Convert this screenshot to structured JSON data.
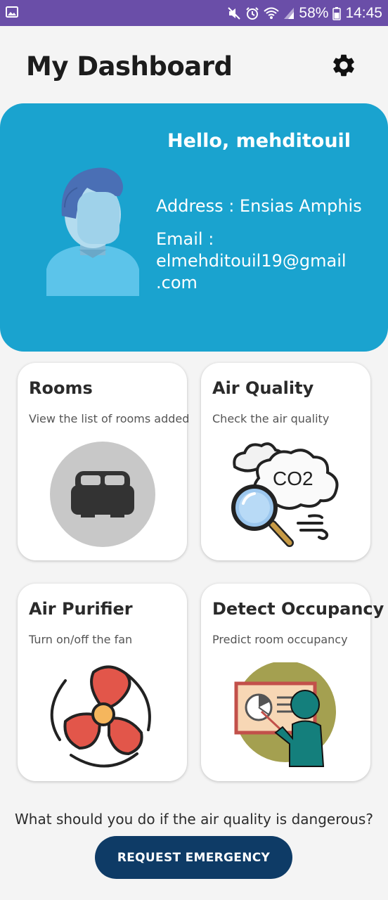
{
  "status_bar": {
    "battery_percent": "58%",
    "time": "14:45",
    "icons": [
      "image-icon",
      "mute-icon",
      "alarm-icon",
      "wifi-icon",
      "signal-icon",
      "battery-icon"
    ],
    "color": "#6a4ea8"
  },
  "header": {
    "title": "My Dashboard",
    "settings_icon": "gear-icon"
  },
  "profile": {
    "greeting": "Hello, mehditouil",
    "address": "Address : Ensias Amphis",
    "email_label": "Email :",
    "email_line1": "elmehditouil19@gmail",
    "email_line2": ".com",
    "color": "#1aa3cf"
  },
  "cards": [
    {
      "title": "Rooms",
      "subtitle": "View the list of rooms added",
      "icon": "bed-icon"
    },
    {
      "title": "Air Quality",
      "subtitle": "Check the air quality",
      "icon": "co2-cloud-icon",
      "icon_text": "CO2"
    },
    {
      "title": "Air Purifier",
      "subtitle": "Turn on/off the fan",
      "icon": "fan-icon"
    },
    {
      "title": "Detect Occupancy",
      "subtitle": "Predict room occupancy",
      "icon": "presentation-icon"
    }
  ],
  "question": "What should you do if the air quality is dangerous?",
  "emergency_button": {
    "label": "REQUEST EMERGENCY",
    "color": "#0e3b66"
  }
}
